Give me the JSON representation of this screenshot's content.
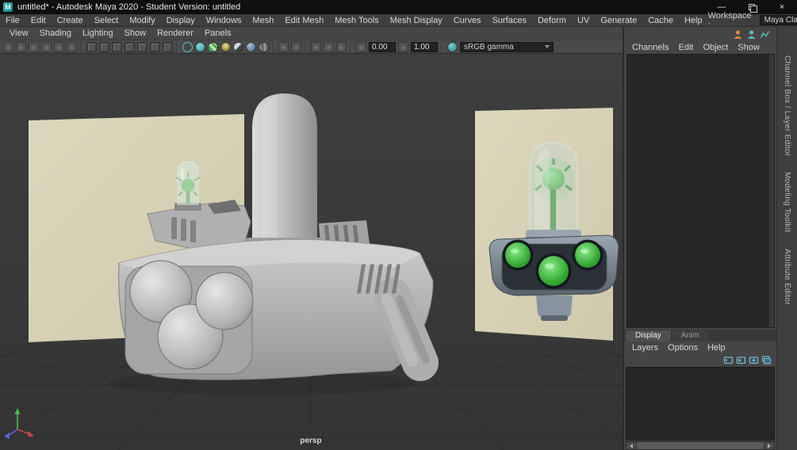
{
  "window": {
    "logo_letter": "M",
    "title": "untitled* - Autodesk Maya 2020 - Student Version: untitled",
    "minimize_glyph": "—",
    "close_glyph": "×"
  },
  "menubar": {
    "items": [
      "File",
      "Edit",
      "Create",
      "Select",
      "Modify",
      "Display",
      "Windows",
      "Mesh",
      "Edit Mesh",
      "Mesh Tools",
      "Mesh Display",
      "Curves",
      "Surfaces",
      "Deform",
      "UV",
      "Generate",
      "Cache",
      "Help"
    ]
  },
  "workspace": {
    "label": "Workspace :",
    "value": "Maya Classic*"
  },
  "panel_menu": {
    "items": [
      "View",
      "Shading",
      "Lighting",
      "Show",
      "Renderer",
      "Panels"
    ]
  },
  "panel_toolbar": {
    "exposure": "0.00",
    "gamma": "1.00",
    "view_transform": "sRGB gamma"
  },
  "viewport": {
    "camera_label": "persp"
  },
  "channel_box": {
    "menus": [
      "Channels",
      "Edit",
      "Object",
      "Show"
    ]
  },
  "side_tabs": {
    "items": [
      "Channel Box / Layer Editor",
      "Modeling Toolkit",
      "Attribute Editor"
    ]
  },
  "layer_panel": {
    "tabs": [
      "Display",
      "Anim"
    ],
    "menus": [
      "Layers",
      "Options",
      "Help"
    ]
  },
  "colors": {
    "panel_bg": "#454545",
    "well_bg": "#262626",
    "viewport_bg": "#383838",
    "reference_beige": "#d7d1b5",
    "model_gray": "#b8b8b8",
    "portal_green": "#3fae3f",
    "accent_teal": "#3fa7a7"
  }
}
